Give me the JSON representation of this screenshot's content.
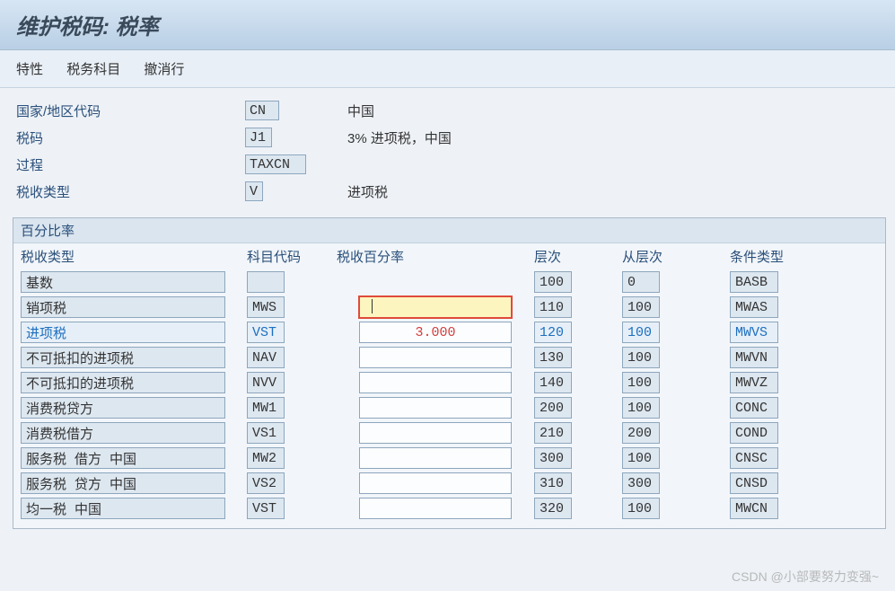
{
  "title": "维护税码: 税率",
  "menu": {
    "properties": "特性",
    "accounts": "税务科目",
    "deactivate": "撤消行"
  },
  "header": {
    "country_label": "国家/地区代码",
    "country_code": "CN",
    "country_name": "中国",
    "taxcode_label": "税码",
    "taxcode": "J1",
    "taxcode_desc": "3% 进项税，中国",
    "procedure_label": "过程",
    "procedure": "TAXCN",
    "taxtype_label": "税收类型",
    "taxtype": "V",
    "taxtype_desc": "进项税"
  },
  "section": {
    "title": "百分比率",
    "columns": {
      "taxtype": "税收类型",
      "acct": "科目代码",
      "pct": "税收百分率",
      "level": "层次",
      "from": "从层次",
      "cond": "条件类型"
    },
    "rows": [
      {
        "taxtype": "基数",
        "acct": "",
        "pct": null,
        "level": "100",
        "from": "0",
        "cond": "BASB",
        "highlight": false,
        "active": false
      },
      {
        "taxtype": "销项税",
        "acct": "MWS",
        "pct": "",
        "level": "110",
        "from": "100",
        "cond": "MWAS",
        "highlight": false,
        "active": true
      },
      {
        "taxtype": "进项税",
        "acct": "VST",
        "pct": "3.000",
        "level": "120",
        "from": "100",
        "cond": "MWVS",
        "highlight": true,
        "active": false
      },
      {
        "taxtype": "不可抵扣的进项税",
        "acct": "NAV",
        "pct": "",
        "level": "130",
        "from": "100",
        "cond": "MWVN",
        "highlight": false,
        "active": false
      },
      {
        "taxtype": "不可抵扣的进项税",
        "acct": "NVV",
        "pct": "",
        "level": "140",
        "from": "100",
        "cond": "MWVZ",
        "highlight": false,
        "active": false
      },
      {
        "taxtype": "消费税贷方",
        "acct": "MW1",
        "pct": "",
        "level": "200",
        "from": "100",
        "cond": "CONC",
        "highlight": false,
        "active": false
      },
      {
        "taxtype": "消费税借方",
        "acct": "VS1",
        "pct": "",
        "level": "210",
        "from": "200",
        "cond": "COND",
        "highlight": false,
        "active": false
      },
      {
        "taxtype": "服务税 借方 中国",
        "acct": "MW2",
        "pct": "",
        "level": "300",
        "from": "100",
        "cond": "CNSC",
        "highlight": false,
        "active": false
      },
      {
        "taxtype": "服务税 贷方 中国",
        "acct": "VS2",
        "pct": "",
        "level": "310",
        "from": "300",
        "cond": "CNSD",
        "highlight": false,
        "active": false
      },
      {
        "taxtype": "均一税 中国",
        "acct": "VST",
        "pct": "",
        "level": "320",
        "from": "100",
        "cond": "MWCN",
        "highlight": false,
        "active": false
      }
    ]
  },
  "watermark": "CSDN @小部要努力变强~"
}
